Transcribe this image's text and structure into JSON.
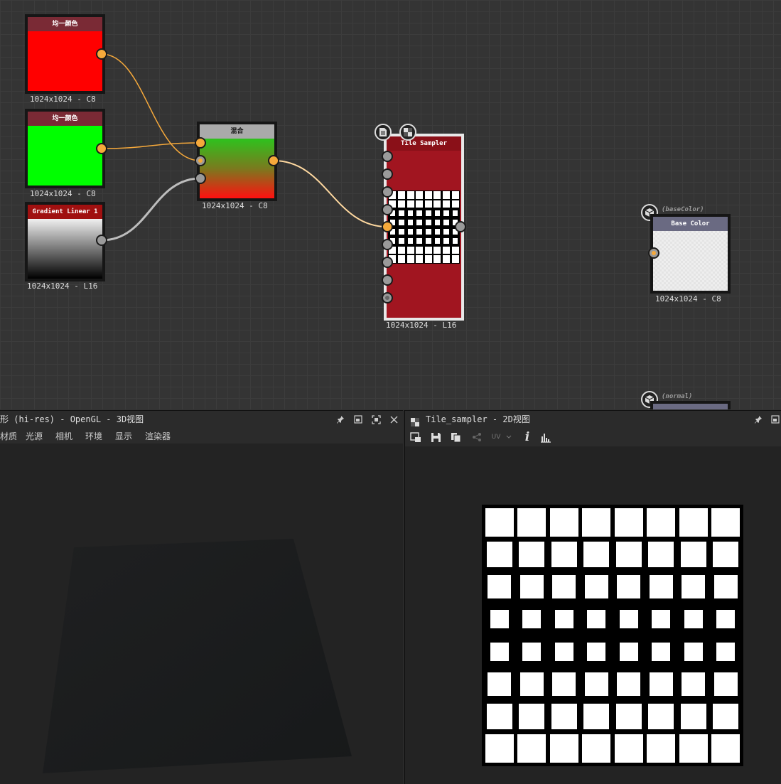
{
  "graph": {
    "nodes": {
      "uniform_red": {
        "title": "均一颜色",
        "resolution": "1024x1024 - C8",
        "color": "#ff0000",
        "header_color": "#7a2a35"
      },
      "uniform_green": {
        "title": "均一颜色",
        "resolution": "1024x1024 - C8",
        "color": "#00ff00",
        "header_color": "#7a2a35"
      },
      "gradient": {
        "title": "Gradient Linear 1",
        "resolution": "1024x1024 - L16",
        "header_color": "#a01010"
      },
      "blend": {
        "title": "混合",
        "resolution": "1024x1024 - C8",
        "header_color": "#aaaaaa"
      },
      "tile_sampler": {
        "title": "Tile Sampler",
        "resolution": "1024x1024 - L16",
        "header_color": "#a11520"
      },
      "base_color": {
        "title": "Base Color",
        "resolution": "1024x1024 - C8",
        "io_label": "(baseColor)",
        "header_color": "#6a6a82"
      },
      "normal": {
        "io_label": "(normal)"
      }
    }
  },
  "panel3d": {
    "title": "形 (hi-res) - OpenGL - 3D视图",
    "menu": [
      "材质",
      "光源",
      "相机",
      "环境",
      "显示",
      "渲染器"
    ]
  },
  "panel2d": {
    "title": "Tile_sampler - 2D视图",
    "uv_label": "UV"
  },
  "icons": [
    "pin-icon",
    "float-icon",
    "maximize-icon",
    "close-icon",
    "camera-icon",
    "save-icon",
    "copy-icon",
    "share-icon",
    "info-icon",
    "histogram-icon",
    "cube-icon",
    "document-icon",
    "checker-icon"
  ]
}
